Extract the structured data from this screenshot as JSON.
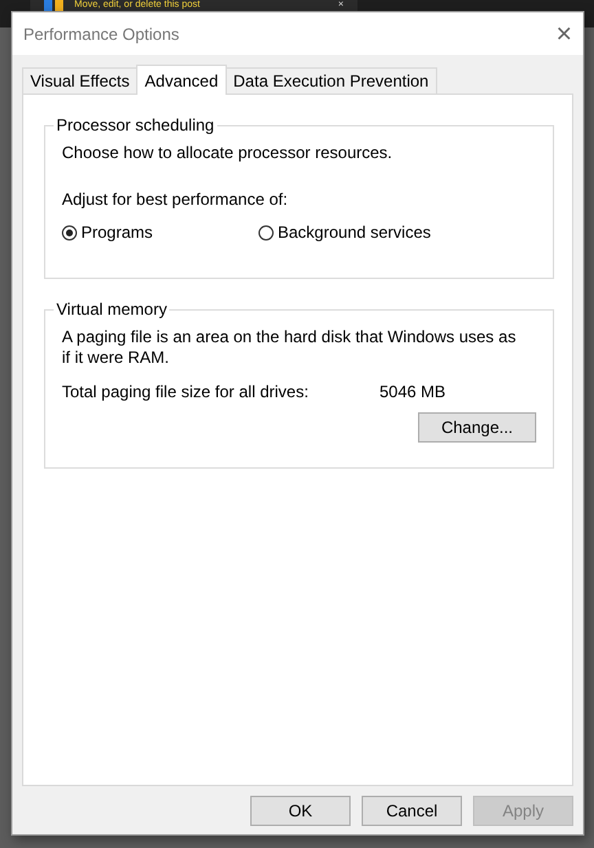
{
  "background_tab": {
    "title": "Move, edit, or delete this post",
    "close": "×"
  },
  "window": {
    "title": "Performance Options",
    "close": "×"
  },
  "tabs": [
    {
      "label": "Visual Effects",
      "selected": false
    },
    {
      "label": "Advanced",
      "selected": true
    },
    {
      "label": "Data Execution Prevention",
      "selected": false
    }
  ],
  "processor_scheduling": {
    "title": "Processor scheduling",
    "description": "Choose how to allocate processor resources.",
    "prompt": "Adjust for best performance of:",
    "options": [
      {
        "label": "Programs",
        "selected": true
      },
      {
        "label": "Background services",
        "selected": false
      }
    ]
  },
  "virtual_memory": {
    "title": "Virtual memory",
    "description": "A paging file is an area on the hard disk that Windows uses as if it were RAM.",
    "size_label": "Total paging file size for all drives:",
    "size_value": "5046 MB",
    "button": "Change..."
  },
  "buttons": [
    {
      "label": "OK",
      "disabled": false
    },
    {
      "label": "Cancel",
      "disabled": false
    },
    {
      "label": "Apply",
      "disabled": true
    }
  ]
}
